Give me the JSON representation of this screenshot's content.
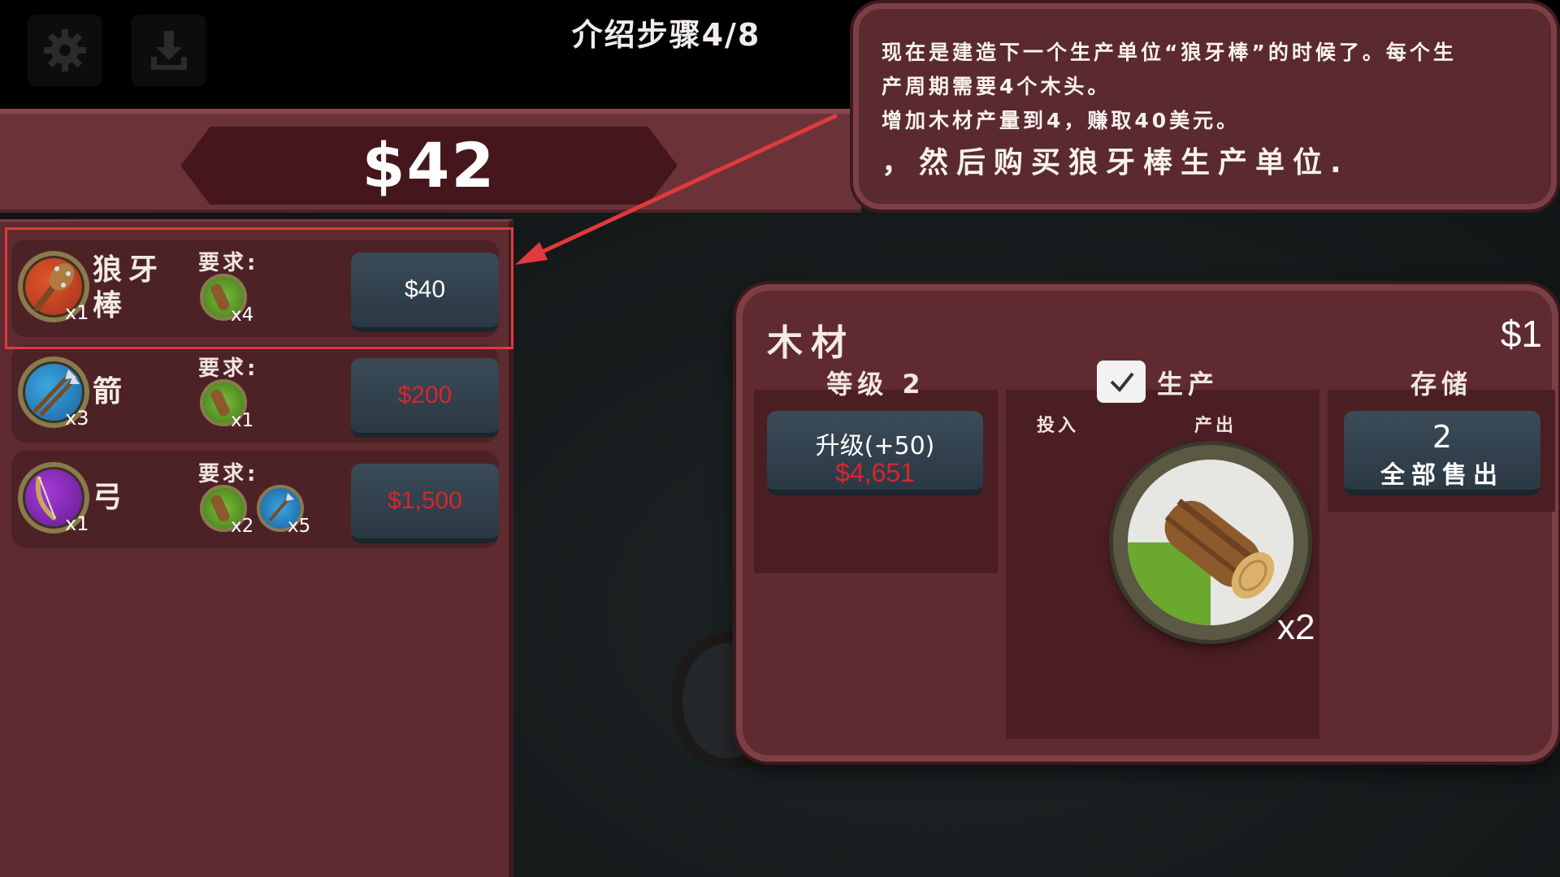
{
  "header": {
    "step_title": "介绍步骤4/8",
    "settings_icon": "gear-icon",
    "save_icon": "download-icon"
  },
  "money": {
    "amount": "$42"
  },
  "tutorial": {
    "line1": "现在是建造下一个生产单位“狼牙棒”的时候了。每个生",
    "line2": "产周期需要4个木头。",
    "line3": "增加木材产量到4，赚取40美元。",
    "line4": "，然后购买狼牙棒生产单位."
  },
  "shop": {
    "items": [
      {
        "name": "狼牙棒",
        "icon": "mace-icon",
        "output_count": "x1",
        "requirement_label": "要求:",
        "requirements": [
          {
            "icon": "wood-icon",
            "count": "x4"
          }
        ],
        "price": "$40",
        "affordable": true
      },
      {
        "name": "箭",
        "icon": "arrow-icon",
        "output_count": "x3",
        "requirement_label": "要求:",
        "requirements": [
          {
            "icon": "wood-icon",
            "count": "x1"
          }
        ],
        "price": "$200",
        "affordable": false
      },
      {
        "name": "弓",
        "icon": "bow-icon",
        "output_count": "x1",
        "requirement_label": "要求:",
        "requirements": [
          {
            "icon": "wood-icon",
            "count": "x2"
          },
          {
            "icon": "arrow-icon",
            "count": "x5"
          }
        ],
        "price": "$1,500",
        "affordable": false
      }
    ]
  },
  "wood_panel": {
    "title": "木材",
    "price": "$1",
    "level_label": "等级 2",
    "upgrade_label": "升级(+50)",
    "upgrade_cost": "$4,651",
    "production_label": "生产",
    "production_checked": true,
    "input_label": "投入",
    "output_label": "产出",
    "output_icon": "log-icon",
    "output_count": "x2",
    "production_progress": 0.25,
    "storage_label": "存储",
    "storage_qty": "2",
    "sell_all_label": "全部售出"
  },
  "colors": {
    "panel": "#5f2b30",
    "button": "#2f3e49",
    "unaffordable": "#d7262b",
    "highlight": "#e03a3e"
  }
}
